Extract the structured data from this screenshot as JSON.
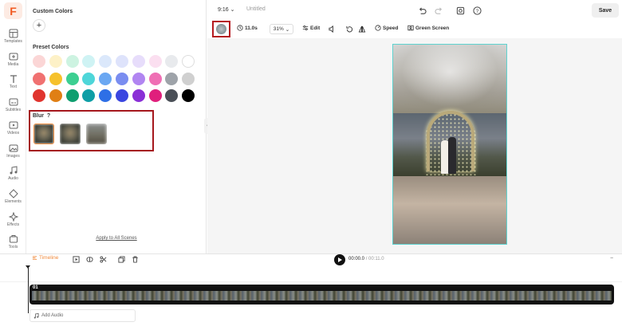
{
  "app": {
    "logo_letter": "F",
    "brand_color": "#f15a22"
  },
  "rail": [
    {
      "label": "Templates",
      "icon": "templates-icon"
    },
    {
      "label": "Media",
      "icon": "media-icon"
    },
    {
      "label": "Text",
      "icon": "text-icon"
    },
    {
      "label": "Subtitles",
      "icon": "subtitles-icon"
    },
    {
      "label": "Videos",
      "icon": "videos-icon"
    },
    {
      "label": "Images",
      "icon": "images-icon"
    },
    {
      "label": "Audio",
      "icon": "audio-icon"
    },
    {
      "label": "Elements",
      "icon": "elements-icon"
    },
    {
      "label": "Effects",
      "icon": "effects-icon"
    },
    {
      "label": "Tools",
      "icon": "tools-icon"
    }
  ],
  "panel": {
    "custom_colors": "Custom Colors",
    "add_symbol": "+",
    "preset_colors": "Preset Colors",
    "colors": [
      "#fbd6d6",
      "#fdf1c7",
      "#cdf3e1",
      "#cff3f4",
      "#dbe8fb",
      "#dee3fb",
      "#e7ddfb",
      "#fbdff0",
      "#e8eaed",
      "#ffffff",
      "#f07171",
      "#f6c12b",
      "#3ccf91",
      "#4ed6d9",
      "#6aa7f2",
      "#7a8df0",
      "#b185f1",
      "#ef6fb4",
      "#9ea3a9",
      "#d0d0d0",
      "#e0342e",
      "#e07f14",
      "#0f9e6f",
      "#0e9ea6",
      "#2e6fe6",
      "#3a46e0",
      "#8a2fd6",
      "#e01f7c",
      "#4a4f57",
      "#000000"
    ],
    "blur_label": "Blur",
    "blur_help": "?",
    "apply_all": "Apply to All Scenes"
  },
  "topbar": {
    "ratio": "9:16",
    "ratio_caret": "⌄",
    "title": "Untitled",
    "save": "Save"
  },
  "toolbar": {
    "duration": "11.0s",
    "zoom": "31%",
    "edit": "Edit",
    "speed": "Speed",
    "green_screen": "Green Screen"
  },
  "timeline": {
    "label": "Timeline",
    "current": "00:00.0",
    "separator": " / ",
    "total": "00:11.0",
    "clip_number": "01",
    "add_audio": "Add Audio",
    "zoom_minus": "−"
  }
}
